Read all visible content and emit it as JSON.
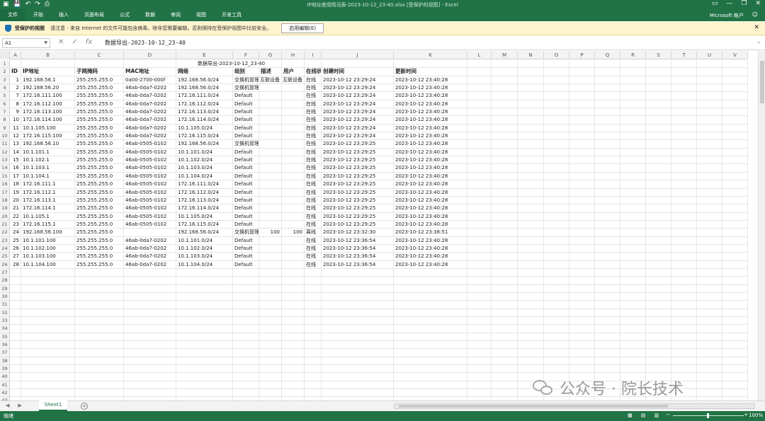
{
  "window": {
    "title": "IP地址使用情况表-2023-10-12_23-40.xlsx [受保护的视图] - Excel",
    "account": "Microsoft 帐户"
  },
  "ribbon": {
    "tabs": [
      "文件",
      "开始",
      "插入",
      "页面布局",
      "公式",
      "数据",
      "审阅",
      "视图",
      "开发工具"
    ]
  },
  "protected_view": {
    "title": "受保护的视图",
    "message": "请注意 - 来自 Internet 的文件可能包含病毒。除非您需要编辑，否则保持在受保护视图中比较安全。",
    "button": "启用编辑(E)"
  },
  "formula_bar": {
    "name_box": "A1",
    "formula": "数据导出-2023-10-12_23-40"
  },
  "columns": [
    "A",
    "B",
    "C",
    "D",
    "E",
    "F",
    "G",
    "H",
    "I",
    "J",
    "K",
    "L",
    "M",
    "N",
    "O",
    "P",
    "Q",
    "R",
    "S",
    "T",
    "U",
    "V"
  ],
  "sheet_title": "数据导出-2023-10-12_23-40",
  "headers": [
    "ID",
    "IP地址",
    "子网掩码",
    "MAC地址",
    "网络",
    "组别",
    "描述",
    "用户",
    "在线状态",
    "创建时间",
    "更新时间"
  ],
  "rows": [
    [
      "1",
      "192.168.56.1",
      "255.255.255.0",
      "0a00-2700-000f",
      "192.168.56.0/24",
      "交换机管理网段",
      "互联设备",
      "互联设备",
      "在线",
      "2023-10-12 23:29:24",
      "2023-10-12 23:40:28"
    ],
    [
      "2",
      "192.168.56.20",
      "255.255.255.0",
      "46ab-0da7-0202",
      "192.168.56.0/24",
      "交换机管理网段",
      "",
      "",
      "在线",
      "2023-10-12 23:29:24",
      "2023-10-12 23:40:28"
    ],
    [
      "7",
      "172.16.111.100",
      "255.255.255.0",
      "46ab-0da7-0202",
      "172.16.111.0/24",
      "Default",
      "",
      "",
      "在线",
      "2023-10-12 23:29:24",
      "2023-10-12 23:40:28"
    ],
    [
      "8",
      "172.16.112.100",
      "255.255.255.0",
      "46ab-0da7-0202",
      "172.16.112.0/24",
      "Default",
      "",
      "",
      "在线",
      "2023-10-12 23:29:24",
      "2023-10-12 23:40:28"
    ],
    [
      "9",
      "172.16.113.100",
      "255.255.255.0",
      "46ab-0da7-0202",
      "172.16.113.0/24",
      "Default",
      "",
      "",
      "在线",
      "2023-10-12 23:29:24",
      "2023-10-12 23:40:28"
    ],
    [
      "10",
      "172.16.114.100",
      "255.255.255.0",
      "46ab-0da7-0202",
      "172.16.114.0/24",
      "Default",
      "",
      "",
      "在线",
      "2023-10-12 23:29:24",
      "2023-10-12 23:40:28"
    ],
    [
      "11",
      "10.1.105.100",
      "255.255.255.0",
      "46ab-0da7-0202",
      "10.1.105.0/24",
      "Default",
      "",
      "",
      "在线",
      "2023-10-12 23:29:24",
      "2023-10-12 23:40:28"
    ],
    [
      "12",
      "172.16.115.100",
      "255.255.255.0",
      "46ab-0da7-0202",
      "172.16.115.0/24",
      "Default",
      "",
      "",
      "在线",
      "2023-10-12 23:29:24",
      "2023-10-12 23:40:28"
    ],
    [
      "13",
      "192.168.56.10",
      "255.255.255.0",
      "46ab-0505-0102",
      "192.168.56.0/24",
      "交换机管理网段",
      "",
      "",
      "在线",
      "2023-10-12 23:29:25",
      "2023-10-12 23:40:28"
    ],
    [
      "14",
      "10.1.101.1",
      "255.255.255.0",
      "46ab-0505-0102",
      "10.1.101.0/24",
      "Default",
      "",
      "",
      "在线",
      "2023-10-12 23:29:25",
      "2023-10-12 23:40:28"
    ],
    [
      "15",
      "10.1.102.1",
      "255.255.255.0",
      "46ab-0505-0102",
      "10.1.102.0/24",
      "Default",
      "",
      "",
      "在线",
      "2023-10-12 23:29:25",
      "2023-10-12 23:40:28"
    ],
    [
      "16",
      "10.1.103.1",
      "255.255.255.0",
      "46ab-0505-0102",
      "10.1.103.0/24",
      "Default",
      "",
      "",
      "在线",
      "2023-10-12 23:29:25",
      "2023-10-12 23:40:28"
    ],
    [
      "17",
      "10.1.104.1",
      "255.255.255.0",
      "46ab-0505-0102",
      "10.1.104.0/24",
      "Default",
      "",
      "",
      "在线",
      "2023-10-12 23:29:25",
      "2023-10-12 23:40:28"
    ],
    [
      "18",
      "172.16.111.1",
      "255.255.255.0",
      "46ab-0505-0102",
      "172.16.111.0/24",
      "Default",
      "",
      "",
      "在线",
      "2023-10-12 23:29:25",
      "2023-10-12 23:40:28"
    ],
    [
      "19",
      "172.16.112.1",
      "255.255.255.0",
      "46ab-0505-0102",
      "172.16.112.0/24",
      "Default",
      "",
      "",
      "在线",
      "2023-10-12 23:29:25",
      "2023-10-12 23:40:28"
    ],
    [
      "20",
      "172.16.113.1",
      "255.255.255.0",
      "46ab-0505-0102",
      "172.16.113.0/24",
      "Default",
      "",
      "",
      "在线",
      "2023-10-12 23:29:25",
      "2023-10-12 23:40:28"
    ],
    [
      "21",
      "172.16.114.1",
      "255.255.255.0",
      "46ab-0505-0102",
      "172.16.114.0/24",
      "Default",
      "",
      "",
      "在线",
      "2023-10-12 23:29:25",
      "2023-10-12 23:40:28"
    ],
    [
      "22",
      "10.1.105.1",
      "255.255.255.0",
      "46ab-0505-0102",
      "10.1.105.0/24",
      "Default",
      "",
      "",
      "在线",
      "2023-10-12 23:29:25",
      "2023-10-12 23:40:28"
    ],
    [
      "23",
      "172.16.115.1",
      "255.255.255.0",
      "46ab-0505-0102",
      "172.16.115.0/24",
      "Default",
      "",
      "",
      "在线",
      "2023-10-12 23:29:25",
      "2023-10-12 23:40:28"
    ],
    [
      "24",
      "192.168.56.100",
      "255.255.255.0",
      "",
      "192.168.56.0/24",
      "交换机管理网段",
      "100",
      "100",
      "离线",
      "2023-10-12 23:32:30",
      "2023-10-12 23:38:51"
    ],
    [
      "25",
      "10.1.101.100",
      "255.255.255.0",
      "46ab-0da7-0202",
      "10.1.101.0/24",
      "Default",
      "",
      "",
      "在线",
      "2023-10-12 23:36:54",
      "2023-10-12 23:40:28"
    ],
    [
      "26",
      "10.1.102.100",
      "255.255.255.0",
      "46ab-0da7-0202",
      "10.1.102.0/24",
      "Default",
      "",
      "",
      "在线",
      "2023-10-12 23:36:54",
      "2023-10-12 23:40:28"
    ],
    [
      "27",
      "10.1.103.100",
      "255.255.255.0",
      "46ab-0da7-0202",
      "10.1.103.0/24",
      "Default",
      "",
      "",
      "在线",
      "2023-10-12 23:36:54",
      "2023-10-12 23:40:28"
    ],
    [
      "28",
      "10.1.104.100",
      "255.255.255.0",
      "46ab-0da7-0202",
      "10.1.104.0/24",
      "Default",
      "",
      "",
      "在线",
      "2023-10-12 23:36:54",
      "2023-10-12 23:40:28"
    ]
  ],
  "total_rows_visible": 43,
  "sheet_tab": "Sheet1",
  "status": {
    "ready": "就绪",
    "zoom": "100%"
  },
  "watermark": "公众号 · 院长技术",
  "colors": {
    "excel_green": "#217346",
    "protected_bar": "#fff4ce"
  }
}
